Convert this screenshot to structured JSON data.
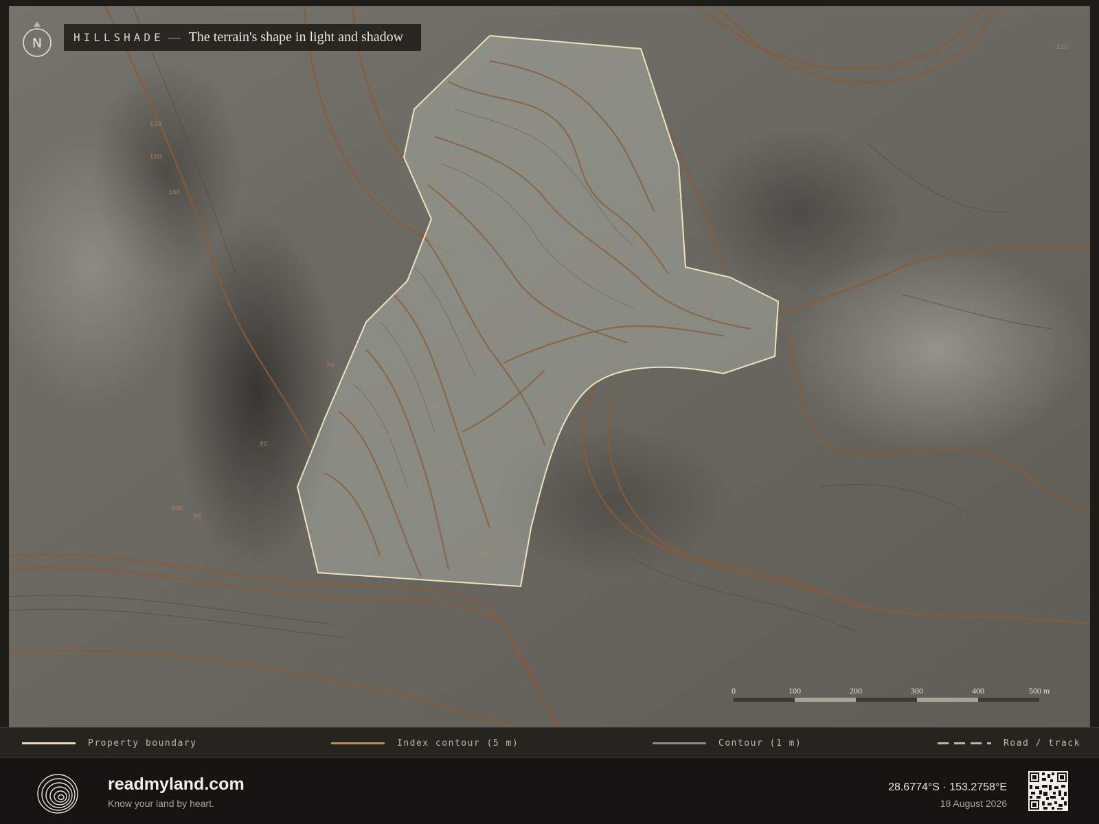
{
  "header": {
    "label": "HILLSHADE",
    "separator": "—",
    "subtitle": "The terrain's shape in light and shadow",
    "compass_letter": "N"
  },
  "contour_labels": [
    "110",
    "130",
    "100",
    "100",
    "70",
    "80",
    "100",
    "90",
    "40",
    "50",
    "30",
    "20"
  ],
  "scale": {
    "ticks": [
      "0",
      "100",
      "200",
      "300",
      "400",
      "500 m"
    ],
    "colors": [
      "#3b3a35",
      "#a8a498",
      "#3b3a35",
      "#a8a498",
      "#3b3a35"
    ]
  },
  "legend": {
    "items": [
      {
        "label": "Property boundary",
        "color": "#e8dcb6"
      },
      {
        "label": "Index contour (5 m)",
        "color": "#c08a5e"
      },
      {
        "label": "Contour (1 m)",
        "color": "#8e8a80"
      },
      {
        "label": "Road / track",
        "color": "#bdb7a6"
      }
    ]
  },
  "footer": {
    "brand": "readmyland.com",
    "tagline": "Know your land by heart.",
    "coordinates": "28.6774°S · 153.2758°E",
    "date": "18 August 2026"
  },
  "colors": {
    "boundary": "#efe3bd",
    "index_contour": "#8a5a38",
    "background": "#1e1c17"
  }
}
